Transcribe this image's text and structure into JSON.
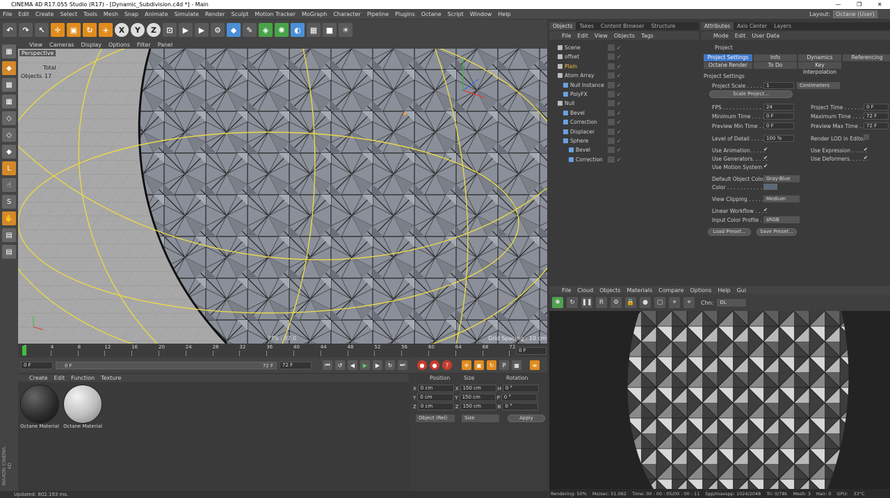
{
  "window": {
    "title": "CINEMA 4D R17.055 Studio (R17) - [Dynamic_Subdivision.c4d *] - Main"
  },
  "menubar": [
    "File",
    "Edit",
    "Create",
    "Select",
    "Tools",
    "Mesh",
    "Snap",
    "Animate",
    "Simulate",
    "Render",
    "Sculpt",
    "Motion Tracker",
    "MoGraph",
    "Character",
    "Pipeline",
    "Plugins",
    "Octane",
    "Script",
    "Window",
    "Help"
  ],
  "layout": {
    "label": "Layout:",
    "value": "Octane (User)"
  },
  "viewport": {
    "menu": [
      "View",
      "Cameras",
      "Display",
      "Options",
      "Filter",
      "Panel"
    ],
    "camera": "Perspective",
    "stats_header": "Total",
    "stats_label": "Objects",
    "stats_value": "17",
    "fps": "FPS : 37.0",
    "grid_spacing": "Grid Spacing : 10 cm"
  },
  "timeline": {
    "ticks": [
      "0",
      "4",
      "8",
      "12",
      "16",
      "20",
      "24",
      "28",
      "32",
      "36",
      "40",
      "44",
      "48",
      "52",
      "56",
      "60",
      "64",
      "68",
      "72"
    ],
    "current_frame": "0 F",
    "start": "0 F",
    "range_start": "0 F",
    "range_end": "72 F",
    "end": "72 F"
  },
  "materials": {
    "menu": [
      "Create",
      "Edit",
      "Function",
      "Texture"
    ],
    "items": [
      {
        "name": "Octane Material",
        "color": "#2a2a2a"
      },
      {
        "name": "Octane Material",
        "color": "#bdbdbd"
      }
    ]
  },
  "coords": {
    "headers": [
      "Position",
      "Size",
      "Rotation"
    ],
    "rows": [
      {
        "axis": "X",
        "pos": "0 cm",
        "size_axis": "X",
        "size": "150 cm",
        "rot_axis": "H",
        "rot": "0 °"
      },
      {
        "axis": "Y",
        "pos": "0 cm",
        "size_axis": "Y",
        "size": "150 cm",
        "rot_axis": "P",
        "rot": "0 °"
      },
      {
        "axis": "Z",
        "pos": "0 cm",
        "size_axis": "Z",
        "size": "150 cm",
        "rot_axis": "B",
        "rot": "0 °"
      }
    ],
    "mode": "Object (Rel)",
    "size_mode": "Size",
    "apply": "Apply"
  },
  "objects": {
    "tabs": [
      "Objects",
      "Takes",
      "Content Browser",
      "Structure"
    ],
    "menu": [
      "File",
      "Edit",
      "View",
      "Objects",
      "Tags"
    ],
    "items": [
      {
        "name": "Scene",
        "depth": 0,
        "color": "#cfcfcf"
      },
      {
        "name": "offset",
        "depth": 0,
        "color": "#cfcfcf"
      },
      {
        "name": "Plain",
        "depth": 0,
        "color": "#f0c33c"
      },
      {
        "name": "Atom Array",
        "depth": 0,
        "color": "#cfcfcf"
      },
      {
        "name": "Null Instance",
        "depth": 1,
        "color": "#cfcfcf"
      },
      {
        "name": "PolyFX",
        "depth": 1,
        "color": "#cfcfcf"
      },
      {
        "name": "Null",
        "depth": 0,
        "color": "#cfcfcf"
      },
      {
        "name": "Bevel",
        "depth": 1,
        "color": "#cfcfcf"
      },
      {
        "name": "Correction",
        "depth": 1,
        "color": "#cfcfcf"
      },
      {
        "name": "Displacer",
        "depth": 1,
        "color": "#cfcfcf"
      },
      {
        "name": "Sphere",
        "depth": 1,
        "color": "#cfcfcf"
      },
      {
        "name": "Bevel",
        "depth": 2,
        "color": "#cfcfcf"
      },
      {
        "name": "Correction",
        "depth": 2,
        "color": "#cfcfcf"
      }
    ]
  },
  "attributes": {
    "tabs": [
      "Attributes",
      "Axis Center",
      "Layers"
    ],
    "menu": [
      "Mode",
      "Edit",
      "User Data"
    ],
    "object": "Project",
    "subtabs_row1": [
      "Project Settings",
      "Info",
      "Dynamics",
      "Referencing"
    ],
    "subtabs_row2": [
      "Octane Render",
      "To Do",
      "Key Interpolation"
    ],
    "section": "Project Settings",
    "project_scale_label": "Project Scale . . . . . .",
    "project_scale_value": "1",
    "project_scale_unit": "Centimeters",
    "scale_project_btn": "Scale Project...",
    "fps_label": "FPS . . . . . . . . . . . . .",
    "fps_value": "24",
    "project_time_label": "Project Time . . . . . . .",
    "project_time_value": "0 F",
    "min_time_label": "Minimum Time . . . . .",
    "min_time_value": "0 F",
    "max_time_label": "Maximum Time . . . . .",
    "max_time_value": "72 F",
    "prev_min_label": "Preview Min Time . . .",
    "prev_min_value": "0 F",
    "prev_max_label": "Preview Max Time . . .",
    "prev_max_value": "72 F",
    "lod_label": "Level of Detail . . . . . .",
    "lod_value": "100 %",
    "render_lod_label": "Render LOD in Editor",
    "use_anim": "Use Animation. . . . .",
    "use_expr": "Use Expression . . . . .",
    "use_gen": "Use Generators. . . . .",
    "use_def": "Use Deformers. . . . . .",
    "use_motion": "Use Motion System",
    "def_color_label": "Default Object Color",
    "def_color_value": "Gray-Blue",
    "color_label": "Color . . . . . . . . . . . .",
    "clipping_label": "View Clipping . . . . . .",
    "clipping_value": "Medium",
    "linear_label": "Linear Workflow . . . .",
    "profile_label": "Input Color Profile . . .",
    "profile_value": "sRGB",
    "load_preset": "Load Preset...",
    "save_preset": "Save Preset..."
  },
  "octane": {
    "menu": [
      "File",
      "Cloud",
      "Objects",
      "Materials",
      "Compare",
      "Options",
      "Help",
      "Gui"
    ],
    "channel_label": "Chn:",
    "channel_value": "DL",
    "status": [
      "Rendering: 50%",
      "Ms/sec: 51.062",
      "Time: 00 : 00 : 05/00 : 00 : 11",
      "Spp/maxspp: 1024/2048",
      "Tri: 0/78k",
      "Mesh: 3",
      "Hair: 0",
      "GPU:",
      "33°C"
    ]
  },
  "statusbar": "Updated: 802.193 ms."
}
